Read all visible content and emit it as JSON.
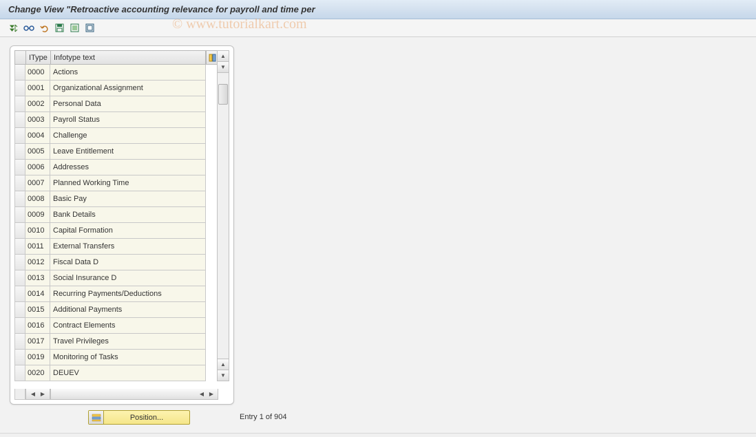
{
  "title": "Change View \"Retroactive accounting relevance for payroll and time per",
  "watermark": "© www.tutorialkart.com",
  "toolbar_icons": [
    {
      "name": "expand-all-icon",
      "color": "#3a7a2a"
    },
    {
      "name": "glasses-icon",
      "color": "#2a5a9a"
    },
    {
      "name": "undo-icon",
      "color": "#c07a2a"
    },
    {
      "name": "save-icon",
      "color": "#2a7a4a"
    },
    {
      "name": "select-all-icon",
      "color": "#2a7a4a"
    },
    {
      "name": "deselect-all-icon",
      "color": "#2a5a7a"
    }
  ],
  "columns": {
    "id": "IType",
    "text": "Infotype text"
  },
  "rows": [
    {
      "id": "0000",
      "text": "Actions"
    },
    {
      "id": "0001",
      "text": "Organizational Assignment"
    },
    {
      "id": "0002",
      "text": "Personal Data"
    },
    {
      "id": "0003",
      "text": "Payroll Status"
    },
    {
      "id": "0004",
      "text": "Challenge"
    },
    {
      "id": "0005",
      "text": "Leave Entitlement"
    },
    {
      "id": "0006",
      "text": "Addresses"
    },
    {
      "id": "0007",
      "text": "Planned Working Time"
    },
    {
      "id": "0008",
      "text": "Basic Pay"
    },
    {
      "id": "0009",
      "text": "Bank Details"
    },
    {
      "id": "0010",
      "text": "Capital Formation"
    },
    {
      "id": "0011",
      "text": "External Transfers"
    },
    {
      "id": "0012",
      "text": "Fiscal Data  D"
    },
    {
      "id": "0013",
      "text": "Social Insurance  D"
    },
    {
      "id": "0014",
      "text": "Recurring Payments/Deductions"
    },
    {
      "id": "0015",
      "text": "Additional Payments"
    },
    {
      "id": "0016",
      "text": "Contract Elements"
    },
    {
      "id": "0017",
      "text": "Travel Privileges"
    },
    {
      "id": "0019",
      "text": "Monitoring of Tasks"
    },
    {
      "id": "0020",
      "text": "DEUEV"
    }
  ],
  "position_button": "Position...",
  "entry_text": "Entry 1 of 904"
}
